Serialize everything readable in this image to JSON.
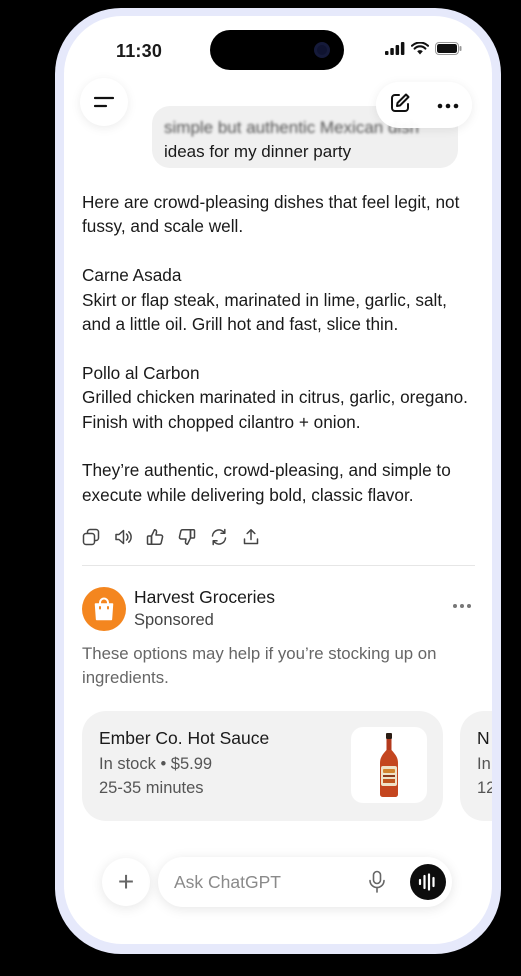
{
  "status_bar": {
    "time": "11:30"
  },
  "header": {
    "menu_icon": "menu-icon",
    "new_chat_icon": "compose-icon",
    "more_icon": "more-icon"
  },
  "user_message": {
    "line1": "simple but authentic Mexican dish",
    "line2": "ideas for my dinner party"
  },
  "assistant": {
    "intro": "Here are crowd-pleasing dishes that feel legit, not fussy, and scale well.",
    "dishes": [
      {
        "name": "Carne Asada",
        "desc": "Skirt or flap steak, marinated in lime, garlic, salt, and a little oil. Grill hot and fast, slice thin."
      },
      {
        "name": "Pollo al Carbon",
        "desc": "Grilled chicken marinated in citrus, garlic, oregano. Finish with chopped cilantro + onion."
      }
    ],
    "outro": "They’re authentic, crowd-pleasing, and simple to execute while delivering bold, classic flavor."
  },
  "ad": {
    "advertiser": "Harvest Groceries",
    "label": "Sponsored",
    "copy": "These options may help if you’re stocking up on ingredients.",
    "accent": "#f4861f",
    "products": [
      {
        "name": "Ember Co. Hot Sauce",
        "stock": "In stock • $5.99",
        "delivery": "25-35 minutes"
      },
      {
        "name": "N",
        "stock": "In",
        "delivery": "12"
      }
    ]
  },
  "composer": {
    "placeholder": "Ask ChatGPT",
    "plus_label": "+"
  }
}
